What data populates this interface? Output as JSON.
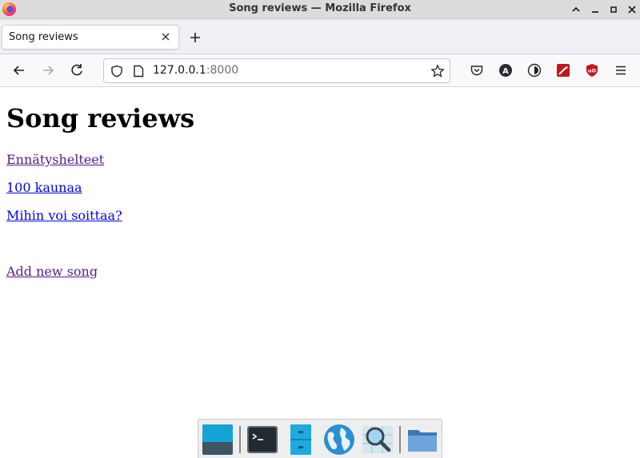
{
  "window": {
    "title": "Song reviews — Mozilla Firefox"
  },
  "tabs": [
    {
      "label": "Song reviews"
    }
  ],
  "address_bar": {
    "host": "127.0.0.1",
    "port": ":8000"
  },
  "page": {
    "heading": "Song reviews",
    "songs": [
      {
        "title": "Ennätyshelteet",
        "visited": true
      },
      {
        "title": "100 kaunaa",
        "visited": false
      },
      {
        "title": "Mihin voi soittaa?",
        "visited": false
      }
    ],
    "add_link": "Add new song"
  },
  "colors": {
    "link": "#0000ee",
    "visited_link": "#551a8b",
    "ublock": "#c4161c"
  },
  "dock": {
    "icons": [
      "desktop-icon",
      "terminal-icon",
      "file-manager-icon",
      "web-browser-icon",
      "search-icon",
      "folder-icon"
    ]
  }
}
